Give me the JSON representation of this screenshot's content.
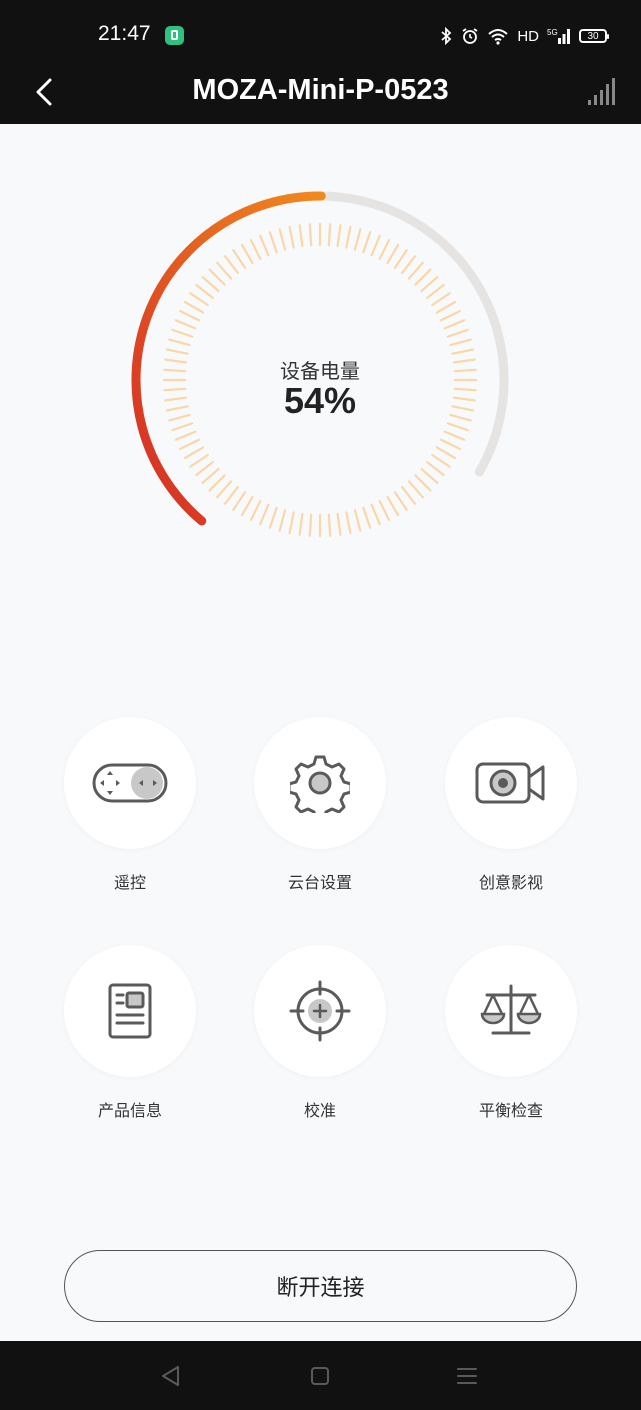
{
  "status_bar": {
    "time": "21:47",
    "network": "HD",
    "network_5g": "5G",
    "battery": "30"
  },
  "header": {
    "title": "MOZA-Mini-P-0523"
  },
  "battery_gauge": {
    "label": "设备电量",
    "value_text": "54%",
    "level": 0.54,
    "colors": {
      "start": "#d42a25",
      "end": "#f08a1d",
      "track": "#e6e4e2",
      "ticks": "#f9d7a9"
    }
  },
  "menu": {
    "items": [
      {
        "label": "遥控",
        "icon": "remote-control-icon"
      },
      {
        "label": "云台设置",
        "icon": "gear-icon"
      },
      {
        "label": "创意影视",
        "icon": "video-camera-icon"
      },
      {
        "label": "产品信息",
        "icon": "product-info-icon"
      },
      {
        "label": "校准",
        "icon": "crosshair-icon"
      },
      {
        "label": "平衡检查",
        "icon": "balance-scale-icon"
      }
    ]
  },
  "disconnect_button": {
    "label": "断开连接"
  },
  "colors": {
    "bar_bg": "#111111",
    "page_bg": "#f7f9fb",
    "icon": "#5a5a5a"
  }
}
